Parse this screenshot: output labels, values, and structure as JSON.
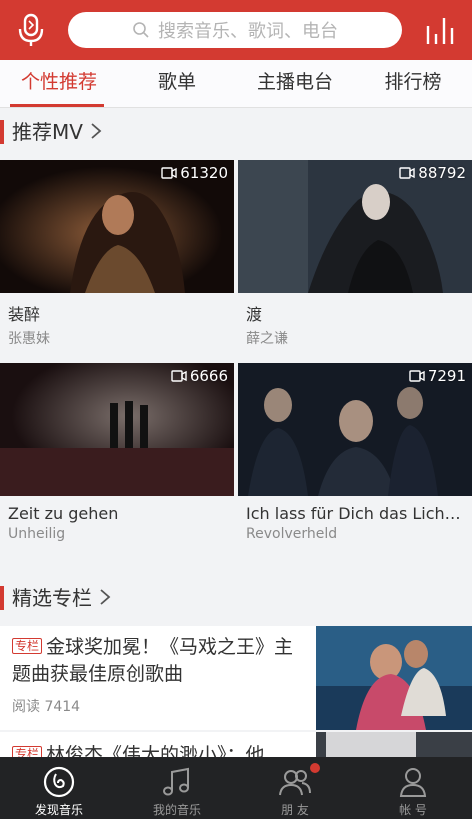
{
  "search": {
    "placeholder": "搜索音乐、歌词、电台"
  },
  "tabs": [
    {
      "label": "个性推荐",
      "active": true
    },
    {
      "label": "歌单"
    },
    {
      "label": "主播电台"
    },
    {
      "label": "排行榜"
    }
  ],
  "sections": {
    "mv": {
      "title": "推荐MV"
    },
    "column": {
      "title": "精选专栏"
    }
  },
  "mvs": [
    {
      "title": "装醉",
      "artist": "张惠妹",
      "count": "61320"
    },
    {
      "title": "渡",
      "artist": "薛之谦",
      "count": "88792"
    },
    {
      "title": "Zeit zu gehen",
      "artist": "Unheilig",
      "count": "6666"
    },
    {
      "title": "Ich lass für Dich das Licht...",
      "artist": "Revolverheld",
      "count": "7291"
    }
  ],
  "columns": [
    {
      "badge": "专栏",
      "title": "金球奖加冕！《马戏之王》主题曲获最佳原创歌曲",
      "reads": "阅读 7414"
    },
    {
      "badge": "专栏",
      "title": "林俊杰《伟大的渺小》：他"
    }
  ],
  "nav": [
    {
      "label": "发现音乐",
      "icon": "discover-icon",
      "active": true
    },
    {
      "label": "我的音乐",
      "icon": "music-note-icon"
    },
    {
      "label": "朋 友",
      "icon": "friends-icon"
    },
    {
      "label": "帐 号",
      "icon": "account-icon"
    }
  ],
  "colors": {
    "accent": "#d33a31",
    "navbar": "#222325"
  }
}
